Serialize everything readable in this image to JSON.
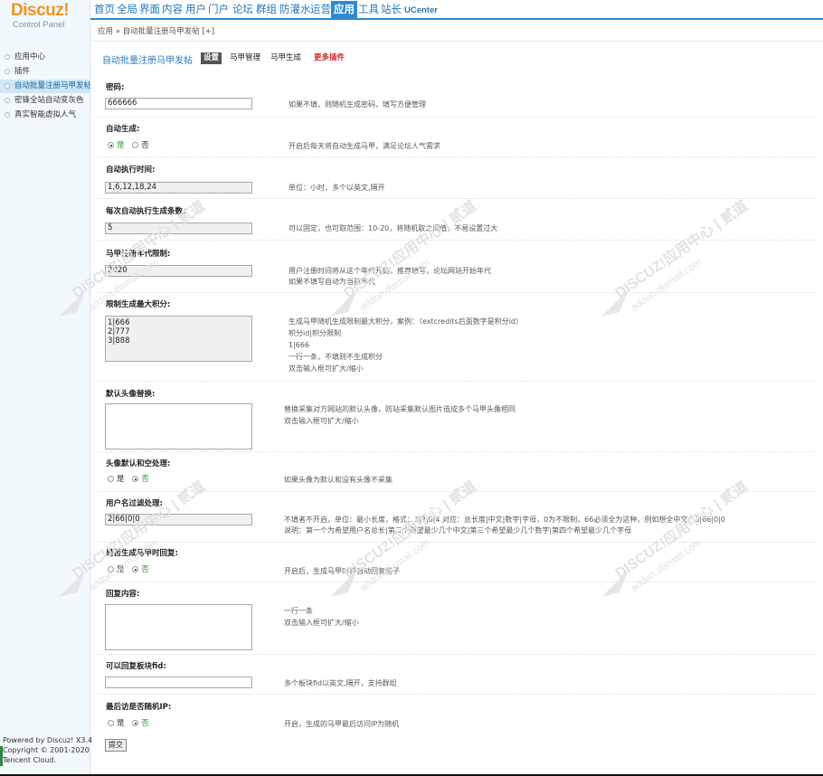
{
  "brand": {
    "name": "Discuz!",
    "subtitle": "Control Panel"
  },
  "nav": {
    "items": [
      "首页",
      "全局",
      "界面",
      "内容",
      "用户",
      "门户",
      "论坛",
      "群组",
      "防灌水",
      "运营",
      "应用",
      "工具",
      "站长",
      "UCenter"
    ],
    "active_index": 10
  },
  "breadcrumb": "应用 » 自动批量注册马甲发帖  [+]",
  "sidebar": {
    "items": [
      "应用中心",
      "插件",
      "自动批量注册马甲发帖",
      "密锋全站自动变灰色",
      "真实智能虚拟人气"
    ],
    "active_index": 2,
    "powered": [
      "Powered by Discuz! X3.4",
      "Copyright © 2001-2020",
      "Tencent Cloud."
    ]
  },
  "subnav": {
    "title": "自动批量注册马甲发帖",
    "tabs": [
      "设置",
      "马甲管理",
      "马甲生成",
      "更多插件"
    ]
  },
  "form": {
    "password": {
      "label": "密码:",
      "value": "666666",
      "tip": "如果不填，则随机生成密码，填写方便管理"
    },
    "auto_generate": {
      "label": "自动生成:",
      "yes": "是",
      "no": "否",
      "selected": "是",
      "tip": "开启后每天将自动生成马甲，满足论坛人气需求"
    },
    "exec_time": {
      "label": "自动执行时间:",
      "value": "1,6,12,18,24",
      "tip": "单位：小时，多个以英文,隔开"
    },
    "exec_count": {
      "label": "每次自动执行生成条数:",
      "value": "5",
      "tip": "可以固定，也可取范围：10-20，将随机取之间值，不易设置过大"
    },
    "reg_year": {
      "label": "马甲注册年代限制:",
      "value": "2020",
      "tips": [
        "用户注册时间将从这个年代开始，推荐填写，论坛网站开始年代",
        "如果不填写自动为当前年代"
      ]
    },
    "max_credits": {
      "label": "限制生成最大积分:",
      "lines": [
        "1|666",
        "2|777",
        "3|888"
      ],
      "tips": [
        "生成马甲随机生成限制最大积分，案例：（extcredits后面数字是积分id）",
        "积分id|积分限制",
        "1|666",
        "一行一条，不填则不生成积分",
        "双击输入框可扩大/缩小"
      ]
    },
    "avatar": {
      "label": "默认头像替换:",
      "tips": [
        "替换采集对方网站的默认头像，防站采集默认图片造成多个马甲头像相同",
        "双击输入框可扩大/缩小"
      ]
    },
    "avatar_empty": {
      "label": "头像默认和空处理:",
      "yes": "是",
      "no": "否",
      "selected": "否",
      "tip": "如果头像为默认和没有头像不采集"
    },
    "username_filter": {
      "label": "用户名过滤处理:",
      "value": "2|66|0|0",
      "tips": [
        "不填者不开启，单位：最小长度，格式：3|3|0|4 对应：总长度|中文|数字|字母，0为不限制，66必须全为这种，例如想全中文：3|66|0|0",
        "说明：第一个为希望用户名总长|第二个希望最少几个中文|第三个希望最少几个数字|第四个希望最少几个字母"
      ]
    },
    "reply_on_gen": {
      "label": "是否生成马甲时回复:",
      "yes": "是",
      "no": "否",
      "selected": "否",
      "tip": "开启后，生成马甲时将自动回复帖子"
    },
    "reply_content": {
      "label": "回复内容:",
      "tips": [
        "一行一条",
        "双击输入框可扩大/缩小"
      ]
    },
    "reply_fids": {
      "label": "可以回复板块fid:",
      "value": "",
      "tip": "多个板块fid以英文,隔开，支持群组"
    },
    "random_ip": {
      "label": "最后访是否随机IP:",
      "yes": "是",
      "no": "否",
      "selected": "否",
      "tip": "开启，生成的马甲最后访问IP为随机"
    },
    "submit_label": "提交"
  },
  "watermark": {
    "line1": "DISCUZ!应用中心 | 贰道",
    "line2": "addon.dismall.com"
  }
}
